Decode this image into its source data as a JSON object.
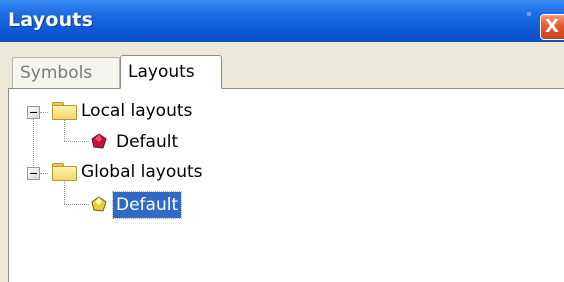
{
  "window": {
    "title": "Layouts",
    "close_glyph": "X"
  },
  "tabs": [
    {
      "label": "Symbols",
      "active": false
    },
    {
      "label": "Layouts",
      "active": true
    }
  ],
  "tree": {
    "nodes": [
      {
        "label": "Local layouts",
        "icon": "folder-icon",
        "expanded": true,
        "children": [
          {
            "label": "Default",
            "icon": "gem-red-icon",
            "selected": false
          }
        ]
      },
      {
        "label": "Global layouts",
        "icon": "folder-icon",
        "expanded": true,
        "children": [
          {
            "label": "Default",
            "icon": "gem-yellow-icon",
            "selected": true
          }
        ]
      }
    ]
  },
  "colors": {
    "titlebar": "#0f5ad6",
    "selection": "#316ac5",
    "gem_red": "#c0143c",
    "gem_yellow": "#e8d23a"
  }
}
